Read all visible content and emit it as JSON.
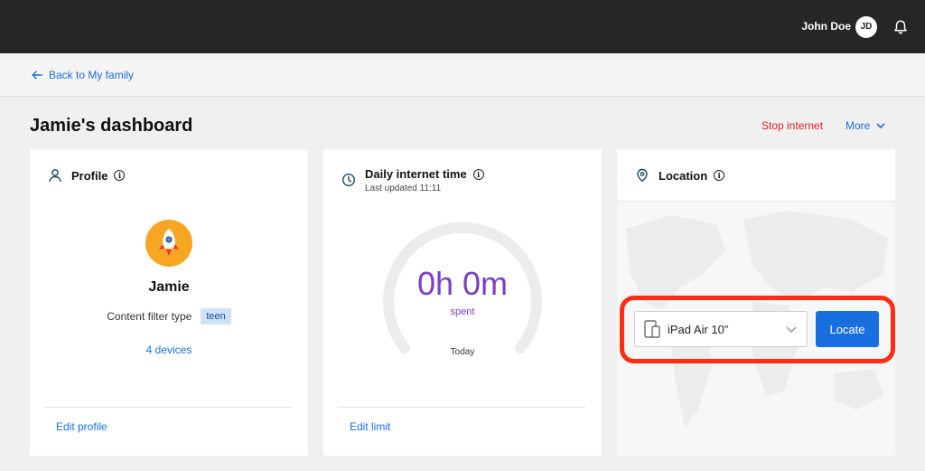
{
  "topbar": {
    "user_name": "John Doe",
    "avatar_initials": "JD",
    "bell_icon": "bell-icon"
  },
  "nav": {
    "back_label": "Back to My family",
    "back_icon": "arrow-left-icon"
  },
  "header": {
    "title": "Jamie's dashboard",
    "stop_internet": "Stop internet",
    "more": "More"
  },
  "profile": {
    "title": "Profile",
    "name": "Jamie",
    "filter_label": "Content filter type",
    "filter_value": "teen",
    "devices": "4 devices",
    "edit": "Edit profile",
    "avatar_icon": "rocket-icon"
  },
  "time": {
    "title": "Daily internet time",
    "updated": "Last updated 11:11",
    "value": "0h 0m",
    "spent": "spent",
    "period": "Today",
    "edit": "Edit limit",
    "fraction_used": 0
  },
  "location": {
    "title": "Location",
    "device": "iPad Air 10”",
    "locate": "Locate",
    "map_icon": "location-pin-icon"
  },
  "colors": {
    "accent": "#1a6fe0",
    "danger": "#e3202b",
    "time_purple": "#7b3fc4",
    "topbar": "#262626",
    "highlight": "#ff2d14"
  }
}
